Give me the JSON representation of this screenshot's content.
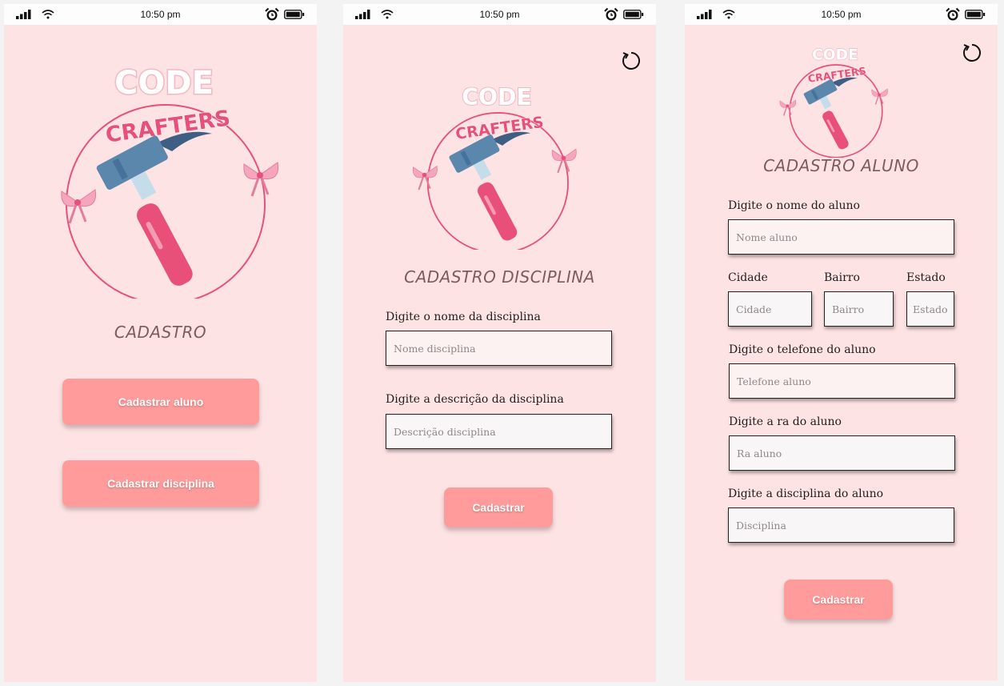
{
  "status_bar": {
    "time": "10:50 pm"
  },
  "screen_home": {
    "title": "CADASTRO",
    "buttons": [
      "Cadastrar aluno",
      "Cadastrar disciplina"
    ]
  },
  "screen_disciplina": {
    "title": "CADASTRO DISCIPLINA",
    "fields": [
      {
        "label": "Digite o nome da disciplina",
        "placeholder": "Nome disciplina"
      },
      {
        "label": "Digite a descrição da disciplina",
        "placeholder": "Descrição disciplina"
      }
    ],
    "submit": "Cadastrar"
  },
  "screen_aluno": {
    "title": "CADASTRO ALUNO",
    "fields": {
      "nome": {
        "label": "Digite o nome do aluno",
        "placeholder": "Nome aluno"
      },
      "cidade": {
        "label": "Cidade",
        "placeholder": "Cidade"
      },
      "bairro": {
        "label": "Bairro",
        "placeholder": "Bairro"
      },
      "estado": {
        "label": "Estado",
        "placeholder": "Estado"
      },
      "telefone": {
        "label": "Digite o telefone do aluno",
        "placeholder": "Telefone aluno"
      },
      "ra": {
        "label": "Digite a ra do aluno",
        "placeholder": "Ra aluno"
      },
      "disciplina": {
        "label": "Digite a disciplina do aluno",
        "placeholder": "Disciplina"
      }
    },
    "submit": "Cadastrar"
  },
  "logo": {
    "line1": "CODE",
    "line2": "CRAFTERS"
  },
  "colors": {
    "background": "#fee3e4",
    "button": "#ff9b9a",
    "logo_pink": "#e8507a",
    "hammer_blue": "#5b87ad"
  },
  "icons": [
    "signal-icon",
    "wifi-icon",
    "alarm-icon",
    "battery-icon",
    "refresh-icon"
  ]
}
